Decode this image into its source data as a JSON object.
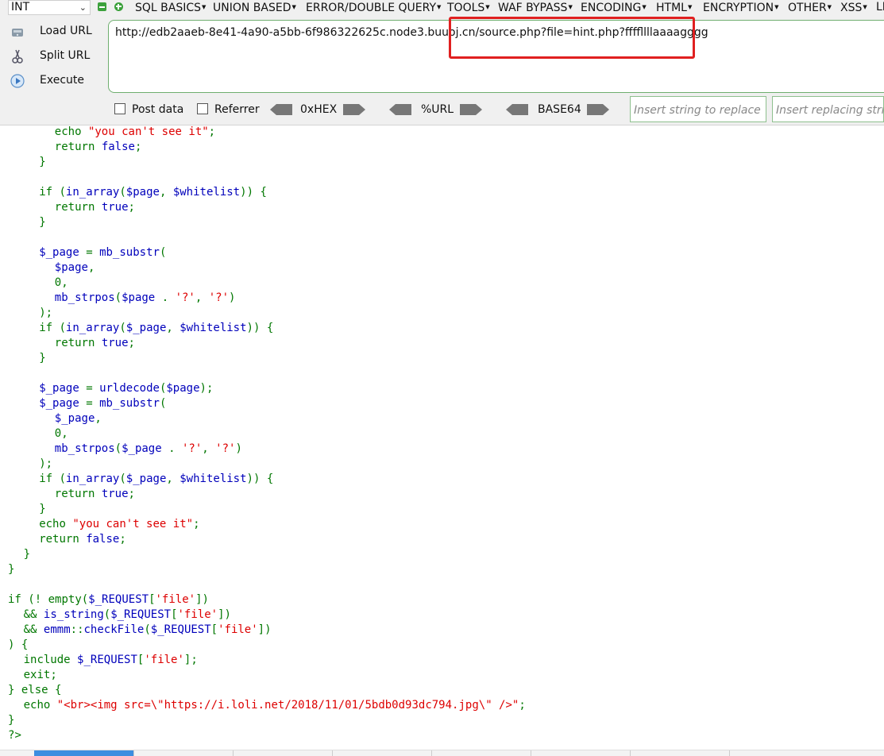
{
  "toolbar": {
    "int_select": "INT",
    "menu": [
      "SQL BASICS",
      "UNION BASED",
      "ERROR/DOUBLE QUERY",
      "TOOLS",
      "WAF BYPASS",
      "ENCODING",
      "HTML",
      "ENCRYPTION",
      "OTHER",
      "XSS",
      "LF"
    ],
    "load_url": "Load URL",
    "split_url": "Split URL",
    "execute": "Execute",
    "url": "http://edb2aaeb-8e41-4a90-a5bb-6f986322625c.node3.buuoj.cn/source.php?file=hint.php?ffffllllaaaagggg",
    "post_data": "Post data",
    "referrer": "Referrer",
    "hex": "0xHEX",
    "url_enc": "%URL",
    "base64": "BASE64",
    "replace_placeholder": "Insert string to replace",
    "replacing_placeholder": "Insert replacing string",
    "highlight_color": "#e02020"
  },
  "code_lines": [
    "            echo \"you can't see it\";",
    "            return false;",
    "        }",
    "",
    "        if (in_array($page, $whitelist)) {",
    "            return true;",
    "        }",
    "",
    "        $_page = mb_substr(",
    "            $page,",
    "            0,",
    "            mb_strpos($page . '?', '?')",
    "        );",
    "        if (in_array($_page, $whitelist)) {",
    "            return true;",
    "        }",
    "",
    "        $_page = urldecode($page);",
    "        $_page = mb_substr(",
    "            $_page,",
    "            0,",
    "            mb_strpos($_page . '?', '?')",
    "        );",
    "        if (in_array($_page, $whitelist)) {",
    "            return true;",
    "        }",
    "        echo \"you can't see it\";",
    "        return false;",
    "    }",
    "}",
    "",
    "if (! empty($_REQUEST['file'])",
    "    && is_string($_REQUEST['file'])",
    "    && emmm::checkFile($_REQUEST['file'])",
    ") {",
    "    include $_REQUEST['file'];",
    "    exit;",
    "} else {",
    "    echo \"<br><img src=\\\"https://i.loli.net/2018/11/01/5bdb0d93dc794.jpg\\\" />\";",
    "}",
    "?>"
  ]
}
